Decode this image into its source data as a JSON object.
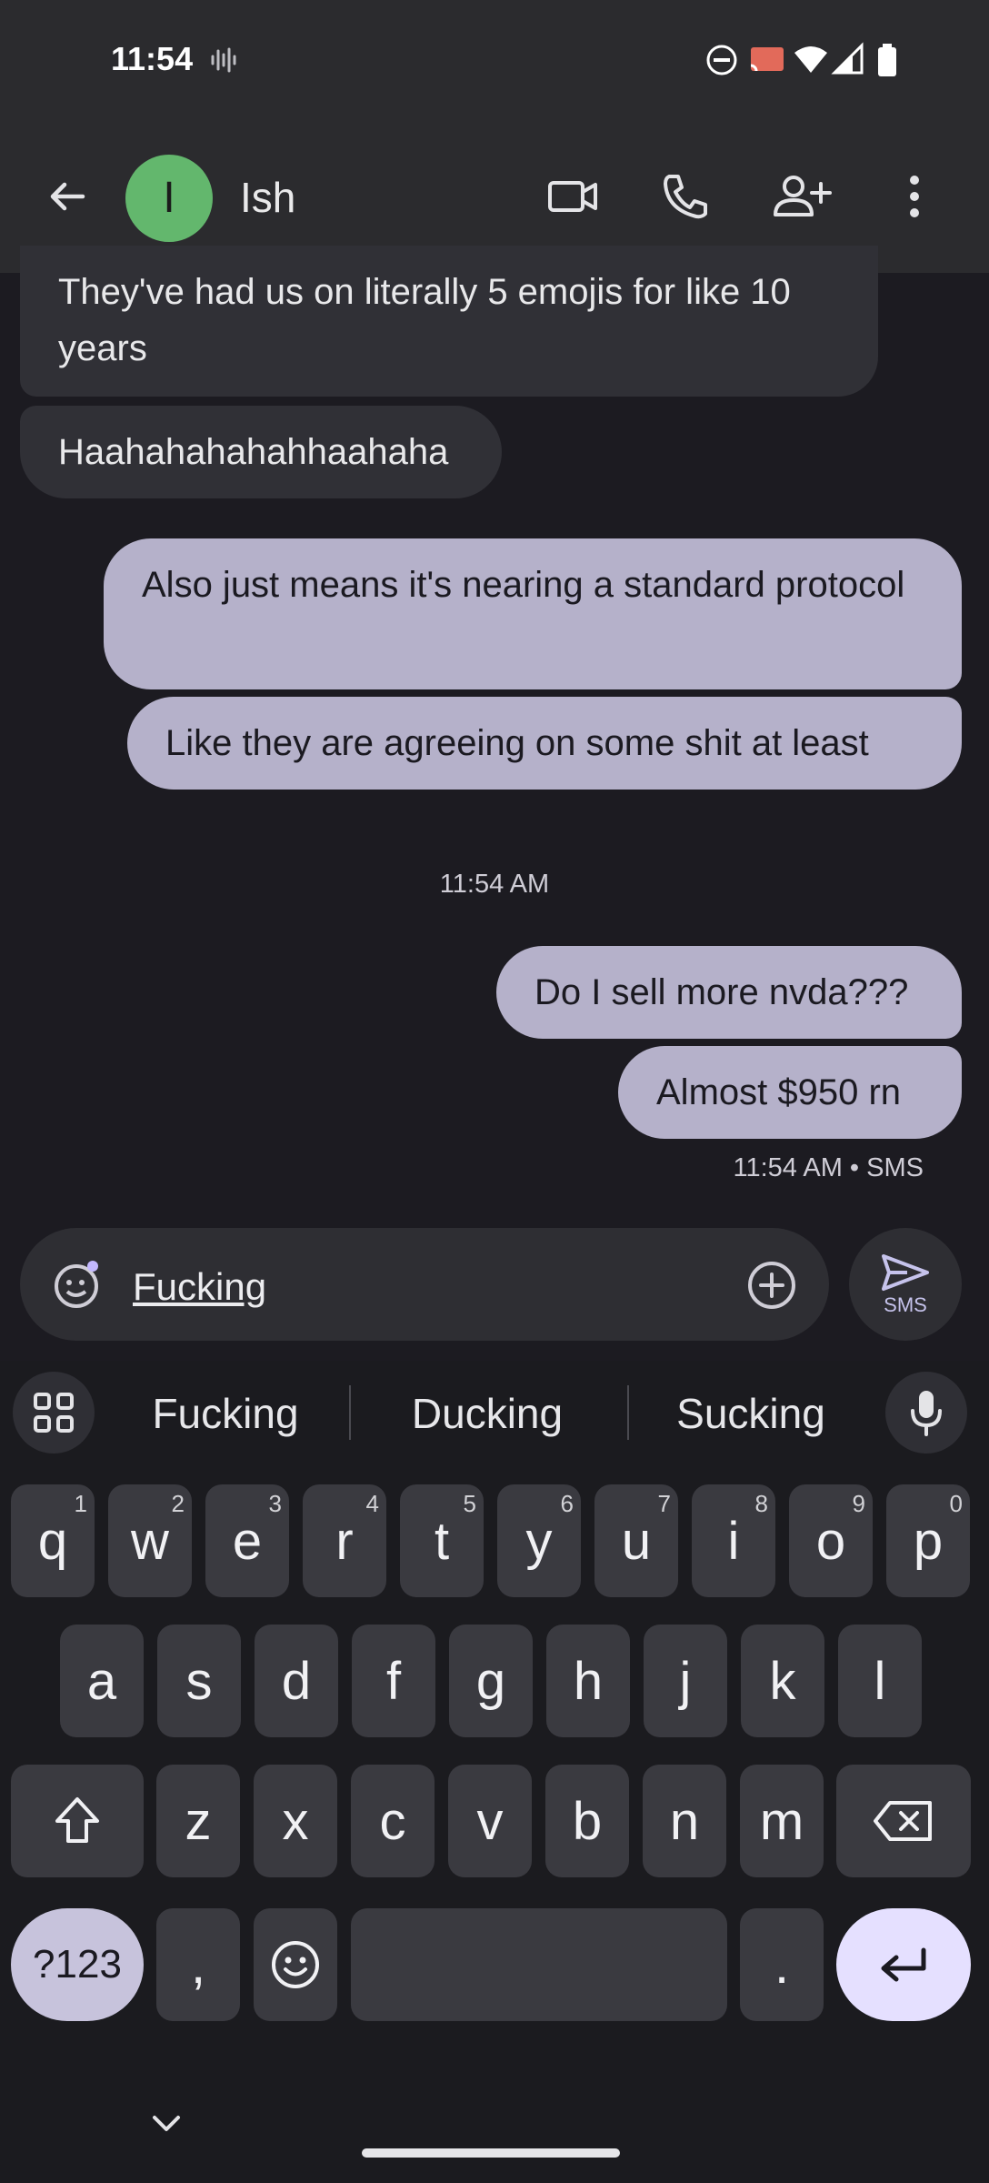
{
  "status_bar": {
    "time": "11:54"
  },
  "header": {
    "avatar_letter": "I",
    "contact_name": "Ish"
  },
  "messages": {
    "m1": "They've had us on literally 5 emojis for like 10 years",
    "m2": "Haahahahahahhaahaha",
    "m3": "Also just means it's nearing a standard protocol",
    "m4": "Like they are agreeing on some shit at least",
    "timestamp": "11:54 AM",
    "m5": "Do I sell more nvda???",
    "m6": "Almost $950 rn",
    "status": "11:54 AM • SMS"
  },
  "compose": {
    "value": "Fucking",
    "send_label": "SMS"
  },
  "keyboard": {
    "suggestions": [
      "Fucking",
      "Ducking",
      "Sucking"
    ],
    "row1": [
      "q",
      "w",
      "e",
      "r",
      "t",
      "y",
      "u",
      "i",
      "o",
      "p"
    ],
    "row1_hints": [
      "1",
      "2",
      "3",
      "4",
      "5",
      "6",
      "7",
      "8",
      "9",
      "0"
    ],
    "row2": [
      "a",
      "s",
      "d",
      "f",
      "g",
      "h",
      "j",
      "k",
      "l"
    ],
    "row3": [
      "z",
      "x",
      "c",
      "v",
      "b",
      "n",
      "m"
    ],
    "symbols_label": "?123",
    "comma": ",",
    "period": "."
  },
  "colors": {
    "avatar": "#63b76d",
    "outgoing_bubble": "#b5b1ca",
    "incoming_bubble": "#303036",
    "enter_key": "#e5e0ff"
  }
}
